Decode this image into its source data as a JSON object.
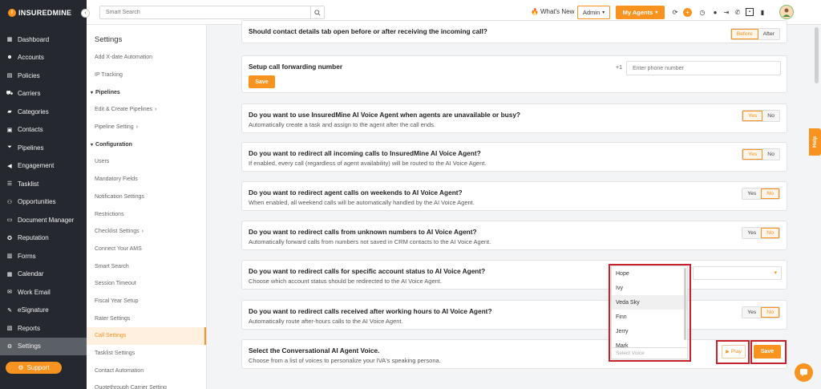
{
  "brand": {
    "name": "INSUREDMINE",
    "collapse_icon": "chevron-left-icon"
  },
  "nav": {
    "items": [
      {
        "label": "Dashboard",
        "icon": "grid-icon",
        "glyph": "▦"
      },
      {
        "label": "Accounts",
        "icon": "users-icon",
        "glyph": "☻"
      },
      {
        "label": "Policies",
        "icon": "document-icon",
        "glyph": "▤"
      },
      {
        "label": "Carriers",
        "icon": "truck-icon",
        "glyph": "⛟"
      },
      {
        "label": "Categories",
        "icon": "folder-icon",
        "glyph": "▰"
      },
      {
        "label": "Contacts",
        "icon": "contact-card-icon",
        "glyph": "▣"
      },
      {
        "label": "Pipelines",
        "icon": "funnel-icon",
        "glyph": "⏷"
      },
      {
        "label": "Engagement",
        "icon": "megaphone-icon",
        "glyph": "◀"
      },
      {
        "label": "Tasklist",
        "icon": "list-icon",
        "glyph": "☰"
      },
      {
        "label": "Opportunities",
        "icon": "people-icon",
        "glyph": "⚇"
      },
      {
        "label": "Document Manager",
        "icon": "folder-open-icon",
        "glyph": "▭"
      },
      {
        "label": "Reputation",
        "icon": "award-icon",
        "glyph": "✪"
      },
      {
        "label": "Forms",
        "icon": "form-icon",
        "glyph": "▥"
      },
      {
        "label": "Calendar",
        "icon": "calendar-icon",
        "glyph": "▦"
      },
      {
        "label": "Work Email",
        "icon": "email-icon",
        "glyph": "✉"
      },
      {
        "label": "eSignature",
        "icon": "signature-icon",
        "glyph": "✎"
      },
      {
        "label": "Reports",
        "icon": "chart-icon",
        "glyph": "▧"
      },
      {
        "label": "Settings",
        "icon": "gear-icon",
        "glyph": "⚙",
        "active": true
      }
    ],
    "support_label": "Support"
  },
  "topbar": {
    "search_placeholder": "Smart Search",
    "whats_new": "What's New",
    "admin_label": "Admin",
    "agents_label": "My Agents",
    "icons": [
      "refresh-icon",
      "plus-circle-icon",
      "clock-icon",
      "bell-icon",
      "logout-icon",
      "phone-icon",
      "chip-icon",
      "battery-icon"
    ]
  },
  "submenu": {
    "title": "Settings",
    "items": [
      {
        "label": "Add X-date Automation"
      },
      {
        "label": "IP Tracking"
      },
      {
        "label": "Pipelines",
        "section": true
      },
      {
        "label": "Edit & Create Pipelines",
        "chevron": "›"
      },
      {
        "label": "Pipeline Setting",
        "chevron": "›"
      },
      {
        "label": "Configuration",
        "section": true
      },
      {
        "label": "Users"
      },
      {
        "label": "Mandatory Fields"
      },
      {
        "label": "Notification Settings"
      },
      {
        "label": "Restrictions"
      },
      {
        "label": "Checklist Settings",
        "chevron": "›"
      },
      {
        "label": "Connect Your AMS"
      },
      {
        "label": "Smart Search"
      },
      {
        "label": "Session Timeout"
      },
      {
        "label": "Fiscal Year Setup"
      },
      {
        "label": "Rater Settings"
      },
      {
        "label": "Call Settings",
        "active": true
      },
      {
        "label": "Tasklist Settings"
      },
      {
        "label": "Contact Automation"
      },
      {
        "label": "Quotethrough Carrier Setting"
      }
    ]
  },
  "cards": {
    "before_after": {
      "question": "Should contact details tab open before or after receiving the incoming call?",
      "option_a": "Before",
      "option_b": "After",
      "selected": "Before"
    },
    "forwarding": {
      "question": "Setup call forwarding number",
      "prefix": "+1",
      "placeholder": "Enter phone number",
      "save_label": "Save"
    },
    "voice_agent_unavailable": {
      "question": "Do you want to use InsuredMine AI Voice Agent when agents are unavailable or busy?",
      "description": "Automatically create a task and assign to the agent after the call ends.",
      "yes": "Yes",
      "no": "No",
      "selected": "Yes"
    },
    "redirect_all": {
      "question": "Do you want to redirect all incoming calls to InsuredMine AI Voice Agent?",
      "description": "If enabled, every call (regardless of agent availability) will be routed to the AI Voice Agent.",
      "yes": "Yes",
      "no": "No",
      "selected": "Yes"
    },
    "weekends": {
      "question": "Do you want to redirect agent calls on weekends to AI Voice Agent?",
      "description": "When enabled, all weekend calls will be automatically handled by the AI Voice Agent.",
      "yes": "Yes",
      "no": "No",
      "selected": "No"
    },
    "unknown_numbers": {
      "question": "Do you want to redirect calls from unknown numbers to AI Voice Agent?",
      "description": "Automatically forward calls from numbers not saved in CRM contacts to the AI Voice Agent.",
      "yes": "Yes",
      "no": "No",
      "selected": "No"
    },
    "account_status": {
      "question": "Do you want to redirect calls for specific account status to AI Voice Agent?",
      "description": "Choose which account status should be redirected to the AI Voice Agent."
    },
    "after_hours": {
      "question": "Do you want to redirect calls received after working hours to AI Voice Agent?",
      "description": "Automatically route after-hours calls to the AI Voice Agent.",
      "yes": "Yes",
      "no": "No",
      "selected": "No"
    },
    "voice": {
      "question": "Select the Conversational AI Agent Voice.",
      "description": "Choose from a list of voices to personalize your IVA's speaking persona.",
      "play_label": "Play",
      "save_label": "Save",
      "placeholder": "Select Voice",
      "options": [
        "Hope",
        "Ivy",
        "Veda Sky",
        "Finn",
        "Jerry",
        "Mark"
      ],
      "highlighted": "Veda Sky"
    }
  },
  "help_tab": "Help",
  "colors": {
    "accent": "#f7931e",
    "sidebar": "#25292f",
    "highlight_box": "#c8232c"
  }
}
